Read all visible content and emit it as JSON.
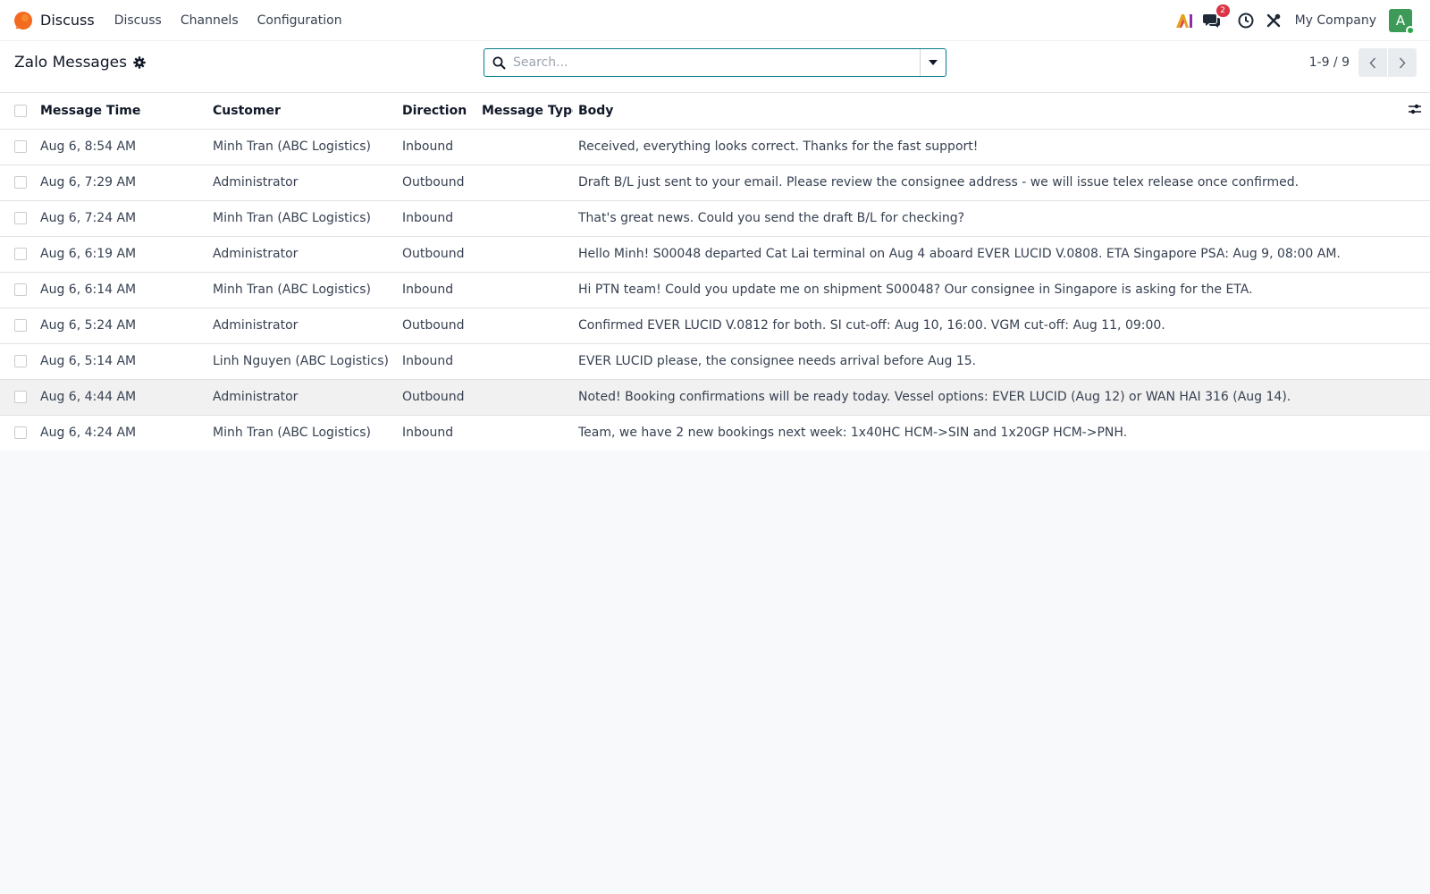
{
  "navbar": {
    "app_name": "Discuss",
    "menu": [
      "Discuss",
      "Channels",
      "Configuration"
    ],
    "message_badge": "2",
    "company": "My Company",
    "avatar_letter": "A"
  },
  "control_panel": {
    "title": "Zalo Messages",
    "search_placeholder": "Search...",
    "pager": "1-9 / 9"
  },
  "table": {
    "columns": [
      "Message Time",
      "Customer",
      "Direction",
      "Message Type",
      "Body"
    ],
    "rows": [
      {
        "time": "Aug 6, 8:54 AM",
        "customer": "Minh Tran (ABC Logistics)",
        "direction": "Inbound",
        "type": "",
        "body": "Received, everything looks correct. Thanks for the fast support!"
      },
      {
        "time": "Aug 6, 7:29 AM",
        "customer": "Administrator",
        "direction": "Outbound",
        "type": "",
        "body": "Draft B/L just sent to your email. Please review the consignee address - we will issue telex release once confirmed."
      },
      {
        "time": "Aug 6, 7:24 AM",
        "customer": "Minh Tran (ABC Logistics)",
        "direction": "Inbound",
        "type": "",
        "body": "That's great news. Could you send the draft B/L for checking?"
      },
      {
        "time": "Aug 6, 6:19 AM",
        "customer": "Administrator",
        "direction": "Outbound",
        "type": "",
        "body": "Hello Minh! S00048 departed Cat Lai terminal on Aug 4 aboard EVER LUCID V.0808. ETA Singapore PSA: Aug 9, 08:00 AM."
      },
      {
        "time": "Aug 6, 6:14 AM",
        "customer": "Minh Tran (ABC Logistics)",
        "direction": "Inbound",
        "type": "",
        "body": "Hi PTN team! Could you update me on shipment S00048? Our consignee in Singapore is asking for the ETA."
      },
      {
        "time": "Aug 6, 5:24 AM",
        "customer": "Administrator",
        "direction": "Outbound",
        "type": "",
        "body": "Confirmed EVER LUCID V.0812 for both. SI cut-off: Aug 10, 16:00. VGM cut-off: Aug 11, 09:00."
      },
      {
        "time": "Aug 6, 5:14 AM",
        "customer": "Linh Nguyen (ABC Logistics)",
        "direction": "Inbound",
        "type": "",
        "body": "EVER LUCID please, the consignee needs arrival before Aug 15."
      },
      {
        "time": "Aug 6, 4:44 AM",
        "customer": "Administrator",
        "direction": "Outbound",
        "type": "",
        "body": "Noted! Booking confirmations will be ready today. Vessel options: EVER LUCID (Aug 12) or WAN HAI 316 (Aug 14)."
      },
      {
        "time": "Aug 6, 4:24 AM",
        "customer": "Minh Tran (ABC Logistics)",
        "direction": "Inbound",
        "type": "",
        "body": "Team, we have 2 new bookings next week: 1x40HC HCM->SIN and 1x20GP HCM->PNH."
      }
    ]
  }
}
